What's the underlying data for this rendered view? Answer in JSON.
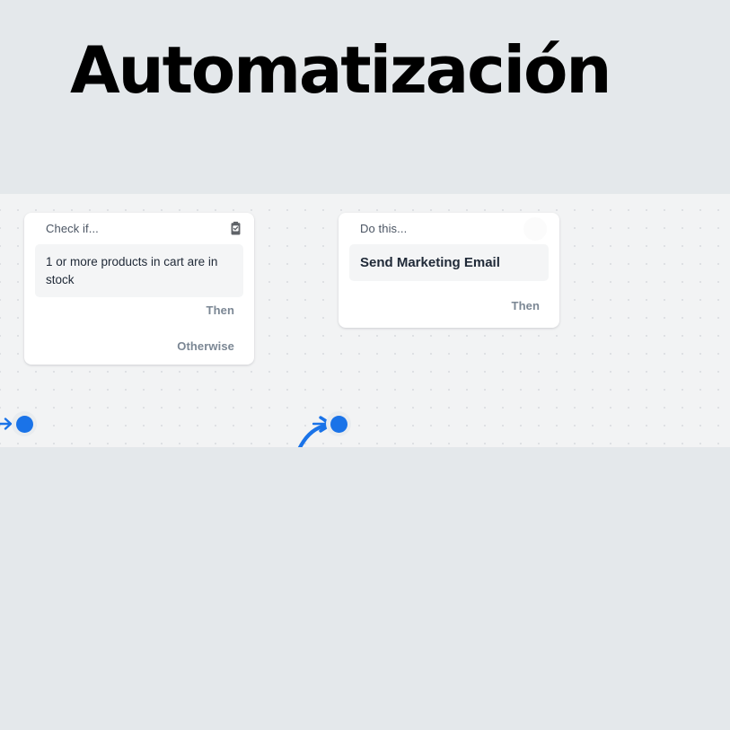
{
  "page": {
    "title": "Automatización",
    "background_color": "#e4e8eb"
  },
  "canvas": {
    "background_color": "#f2f3f4",
    "grid": "dotted",
    "accent_color": "#1a73e8"
  },
  "nodes": [
    {
      "id": "check-node",
      "header_label": "Check if...",
      "header_icon": "clipboard-check-icon",
      "condition_text": "1 or more products in cart are in stock",
      "outputs": [
        {
          "label": "Then",
          "port": "then-port"
        },
        {
          "label": "Otherwise",
          "port": "otherwise-port"
        }
      ],
      "input_port": "input-port"
    },
    {
      "id": "action-node",
      "header_label": "Do this...",
      "header_icon": "circle-placeholder-icon",
      "action_text": "Send Marketing Email",
      "outputs": [
        {
          "label": "Then",
          "port": "then-port"
        }
      ],
      "input_port": "input-port"
    }
  ],
  "connector": {
    "from": "check-node.then",
    "to": "action-node.input",
    "color": "#1a73e8",
    "style": "bezier-arrow"
  }
}
